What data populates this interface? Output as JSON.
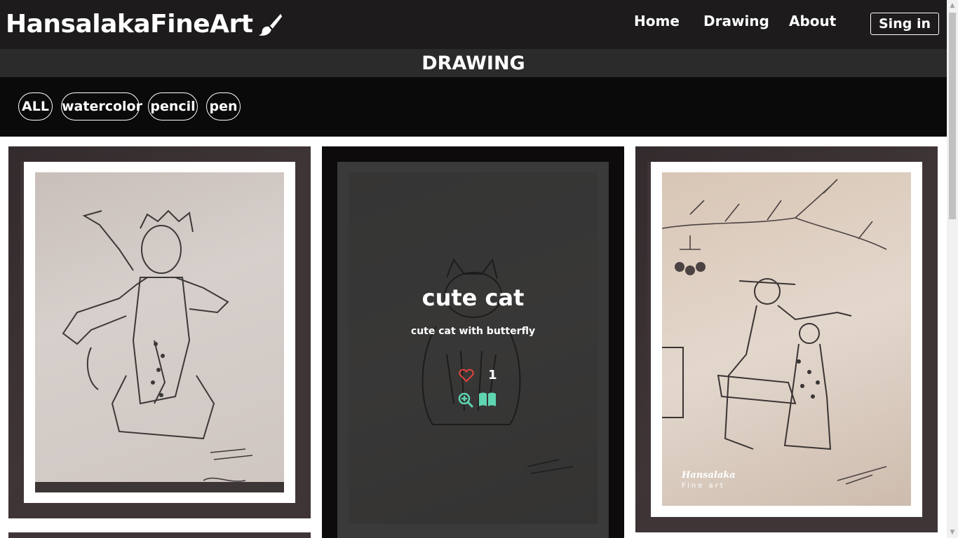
{
  "brand": {
    "name": "HansalakaFineArt",
    "icon": "paintbrush-icon"
  },
  "nav": {
    "items": [
      "Home",
      "Drawing",
      "About"
    ],
    "signin_label": "Sing in"
  },
  "section": {
    "title": "DRAWING"
  },
  "filters": [
    "ALL",
    "watercolor",
    "pencil",
    "pen"
  ],
  "gallery": {
    "hover_card": {
      "title": "cute cat",
      "description": "cute cat with butterfly",
      "likes": "1"
    },
    "watermark": {
      "line1": "Hansalaka",
      "line2": "Fine art"
    }
  },
  "colors": {
    "header_bg": "#1d1b1b",
    "band_bg": "#2b2b2b",
    "filter_bg": "#0a0a0a",
    "frame": "#3f3536",
    "like_heart": "#e0463f",
    "action_icons": "#5fd5b2"
  }
}
